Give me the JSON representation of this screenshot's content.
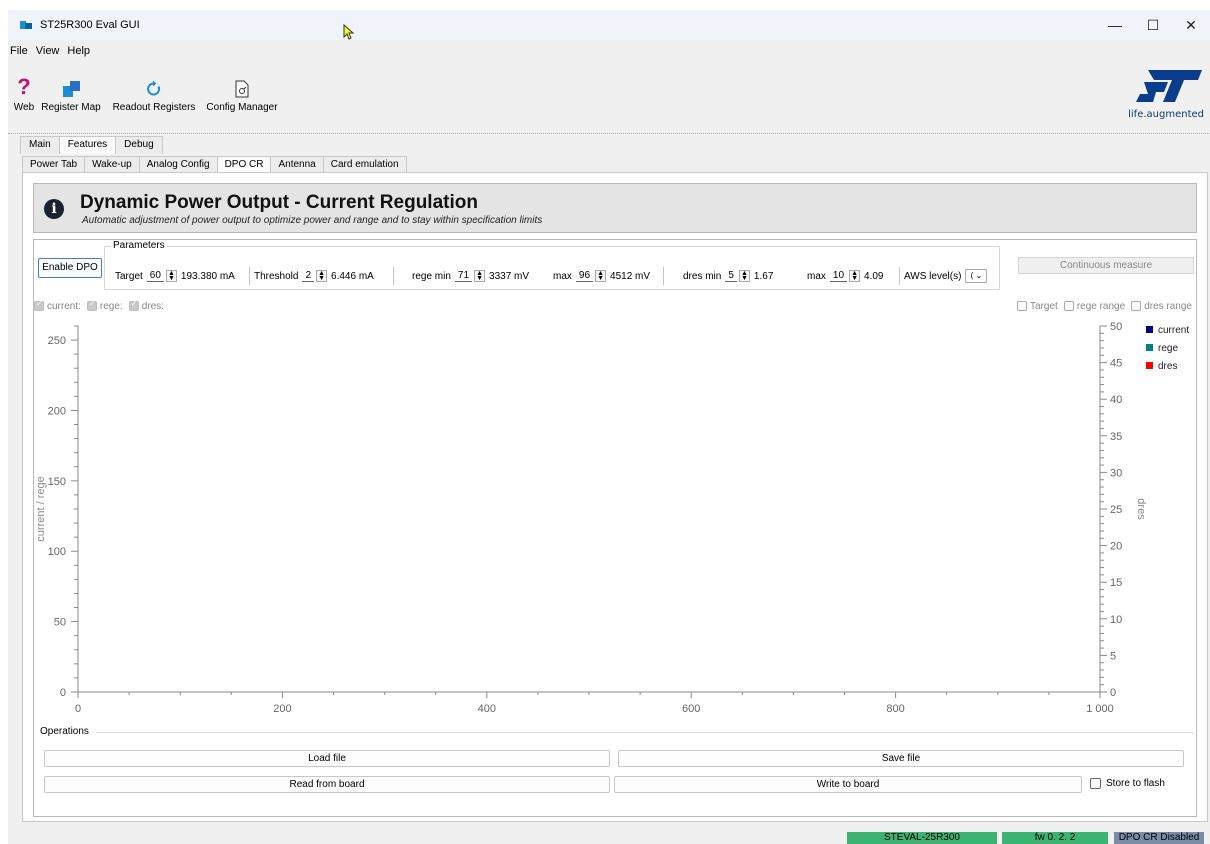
{
  "window": {
    "title": "ST25R300 Eval GUI",
    "minimize": "—",
    "maximize": "☐",
    "close": "✕"
  },
  "menu": [
    "File",
    "View",
    "Help"
  ],
  "toolbar": {
    "items": [
      {
        "label": "Web",
        "icon": "help-question-icon"
      },
      {
        "label": "Register Map",
        "icon": "register-map-icon"
      },
      {
        "label": "Readout Registers",
        "icon": "refresh-icon"
      },
      {
        "label": "Config Manager",
        "icon": "config-document-icon"
      }
    ],
    "logo_tagline": "life.augmented"
  },
  "main_tabs": [
    "Main",
    "Features",
    "Debug"
  ],
  "active_main_tab": "Features",
  "sub_tabs": [
    "Power Tab",
    "Wake-up",
    "Analog Config",
    "DPO CR",
    "Antenna",
    "Card emulation"
  ],
  "active_sub_tab": "DPO CR",
  "header": {
    "title": "Dynamic Power Output - Current Regulation",
    "subtitle": "Automatic adjustment of power output to optimize power and range and to stay within specification limits"
  },
  "controls": {
    "enable_button": "Enable DPO",
    "params_title": "Parameters",
    "target_label": "Target",
    "target_value": "60",
    "target_readout": "193.380 mA",
    "threshold_label": "Threshold",
    "threshold_value": "2",
    "threshold_readout": "6.446 mA",
    "rege_min_label": "rege min",
    "rege_min_value": "71",
    "rege_min_readout": "3337 mV",
    "rege_max_label": "max",
    "rege_max_value": "96",
    "rege_max_readout": "4512 mV",
    "dres_min_label": "dres min",
    "dres_min_value": "5",
    "dres_min_readout": "1.67",
    "dres_max_label": "max",
    "dres_max_value": "10",
    "dres_max_readout": "4.09",
    "aws_label": "AWS level(s)",
    "aws_value": "(",
    "continuous_button": "Continuous measure"
  },
  "plot_toggles": {
    "left": [
      {
        "label": "current:",
        "checked": true
      },
      {
        "label": "rege:",
        "checked": true
      },
      {
        "label": "dres:",
        "checked": true
      }
    ],
    "right": [
      {
        "label": "Target",
        "checked": false
      },
      {
        "label": "rege range",
        "checked": false
      },
      {
        "label": "dres range",
        "checked": false
      }
    ]
  },
  "chart_data": {
    "type": "line",
    "x_ticks": [
      "0",
      "200",
      "400",
      "600",
      "800",
      "1 000"
    ],
    "xlim": [
      0,
      1000
    ],
    "y_left_label": "current / rege",
    "y_left_ticks": [
      "0",
      "50",
      "100",
      "150",
      "200",
      "250"
    ],
    "ylim_left": [
      0,
      260
    ],
    "y_right_label": "dres",
    "y_right_ticks": [
      "0",
      "5",
      "10",
      "15",
      "20",
      "25",
      "30",
      "35",
      "40",
      "45",
      "50"
    ],
    "ylim_right": [
      0,
      50
    ],
    "series": [
      {
        "name": "current",
        "color": "#000080",
        "values": []
      },
      {
        "name": "rege",
        "color": "#008080",
        "values": []
      },
      {
        "name": "dres",
        "color": "#ff0000",
        "values": []
      }
    ],
    "legend_position": "top-right"
  },
  "operations": {
    "title": "Operations",
    "load": "Load file",
    "save": "Save file",
    "read": "Read from board",
    "write": "Write to board",
    "store_flash": "Store to flash"
  },
  "status": {
    "board": "STEVAL-25R300",
    "fw": "fw  0. 2. 2",
    "dpo": "DPO CR Disabled",
    "board_color": "#3cb371",
    "fw_color": "#3cb371",
    "dpo_color": "#7a8ca8"
  }
}
